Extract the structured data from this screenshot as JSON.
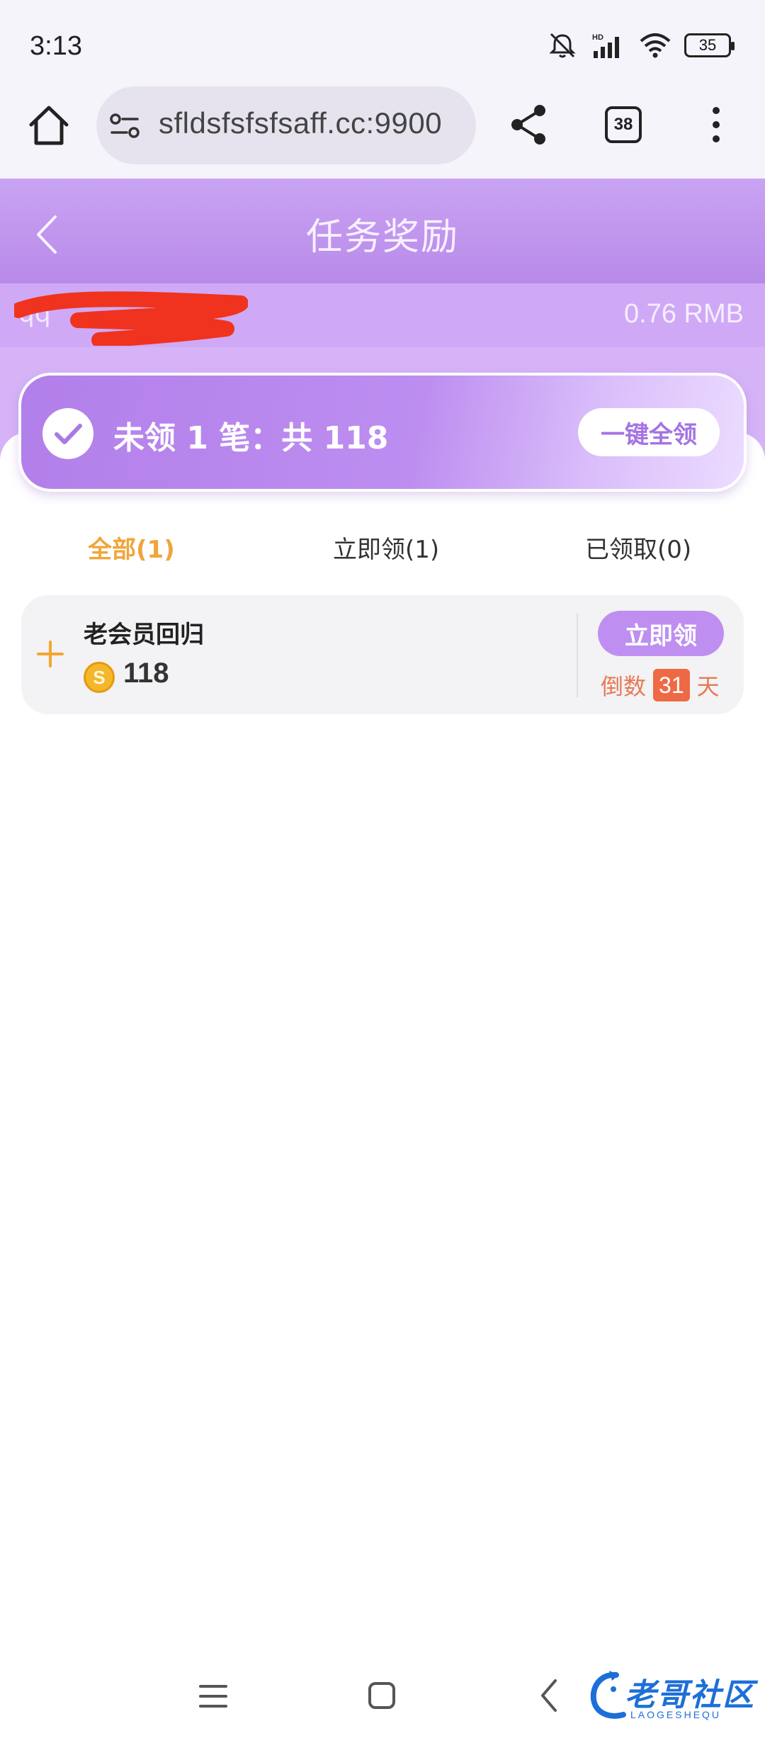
{
  "status_bar": {
    "time": "3:13",
    "network_label": "HD",
    "battery": "35"
  },
  "browser": {
    "url": "sfldsfsfsfsaff.cc:9900",
    "tabs_count": "38"
  },
  "header": {
    "title": "任务奖励"
  },
  "account": {
    "name": "qq",
    "balance": "0.76 RMB"
  },
  "summary": {
    "text": "未领 1 笔：共 118",
    "claim_all_label": "一键全领"
  },
  "tabs": [
    {
      "label": "全部(1)",
      "active": true
    },
    {
      "label": "立即领(1)",
      "active": false
    },
    {
      "label": "已领取(0)",
      "active": false
    }
  ],
  "tasks": [
    {
      "name": "老会员回归",
      "coin_symbol": "S",
      "amount": "118",
      "claim_label": "立即领",
      "countdown_prefix": "倒数",
      "countdown_days": "31",
      "countdown_suffix": "天"
    }
  ],
  "watermark": {
    "text": "老哥社区",
    "sub": "LAOGESHEQU"
  },
  "colors": {
    "accent_purple": "#be8ff0",
    "header_purple": "#c9a3f3",
    "active_tab": "#f0a53a",
    "countdown": "#ee6a45"
  }
}
